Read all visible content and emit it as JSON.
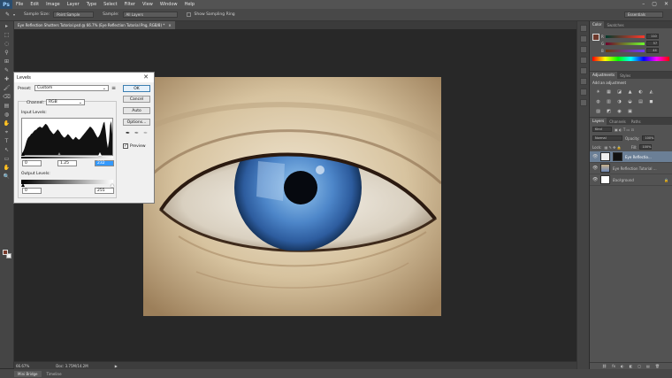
{
  "app": {
    "logo": "Ps"
  },
  "menu": [
    "File",
    "Edit",
    "Image",
    "Layer",
    "Type",
    "Select",
    "Filter",
    "View",
    "Window",
    "Help"
  ],
  "window_controls": [
    "–",
    "▢",
    "✕"
  ],
  "options_bar": {
    "sample_size_label": "Sample Size:",
    "sample_size_value": "Point Sample",
    "sample_label": "Sample:",
    "sample_value": "All Layers",
    "show_ring_label": "Show Sampling Ring",
    "workspace_value": "Essentials"
  },
  "document_tab": {
    "title": "Eye Reflection Shutters Tutorial.psd @ 66.7% (Eye Reflection Tutorial Png, RGB/8) *",
    "close": "×"
  },
  "status_bar": {
    "zoom": "66.67%",
    "doc": "Doc: 3.75M/14.2M",
    "arrow": "▶"
  },
  "bottom_tabs": [
    "Mini Bridge",
    "Timeline"
  ],
  "color_panel": {
    "tabs": [
      "Color",
      "Swatches"
    ],
    "rows": [
      {
        "label": "R",
        "value": "110",
        "track": "#ff6e6e"
      },
      {
        "label": "G",
        "value": "57",
        "track": "#6eff6e"
      },
      {
        "label": "B",
        "value": "44",
        "track": "#6e6eff"
      }
    ],
    "fg_color": "#6e392c"
  },
  "adjustments_panel": {
    "tabs": [
      "Adjustments",
      "Styles"
    ],
    "heading": "Add an adjustment",
    "icons": [
      "☀",
      "▦",
      "◪",
      "▲",
      "◐",
      "◭",
      "◍",
      "▥",
      "◑",
      "◒",
      "▤",
      "◼",
      "▨",
      "◩",
      "◉",
      "▣"
    ]
  },
  "layers_panel": {
    "tabs": [
      "Layers",
      "Channels",
      "Paths"
    ],
    "kind_label": "Kind",
    "blend_mode": "Normal",
    "opacity_label": "Opacity:",
    "opacity_value": "100%",
    "lock_label": "Lock:",
    "fill_label": "Fill:",
    "fill_value": "100%",
    "layers": [
      {
        "name": "Eye Reflectio...",
        "selected": true
      },
      {
        "name": "Eye Reflection Tutorial ...",
        "selected": false
      },
      {
        "name": "Background",
        "selected": false,
        "locked": "🔒"
      }
    ],
    "footer_icons": [
      "⛓",
      "fx",
      "◐",
      "◧",
      "▢",
      "▤",
      "🗑"
    ]
  },
  "levels_dialog": {
    "title": "Levels",
    "close": "✕",
    "preset_label": "Preset:",
    "preset_value": "Custom",
    "preset_menu_icon": "≡",
    "channel_label": "Channel:",
    "channel_value": "RGB",
    "input_levels_label": "Input Levels:",
    "input_levels": [
      "0",
      "1.25",
      "232"
    ],
    "output_levels_label": "Output Levels:",
    "output_levels": [
      "0",
      "255"
    ],
    "buttons": [
      "OK",
      "Cancel",
      "Auto",
      "Options..."
    ],
    "preview_label": "Preview",
    "preview_checked": true,
    "histogram_heights": [
      0.05,
      0.1,
      0.18,
      0.28,
      0.4,
      0.48,
      0.52,
      0.55,
      0.6,
      0.62,
      0.66,
      0.7,
      0.72,
      0.74,
      0.78,
      0.8,
      0.82,
      0.8,
      0.78,
      0.82,
      0.86,
      0.9,
      0.88,
      0.84,
      0.78,
      0.72,
      0.68,
      0.64,
      0.6,
      0.62,
      0.66,
      0.7,
      0.74,
      0.7,
      0.66,
      0.6,
      0.56,
      0.52,
      0.5,
      0.52,
      0.56,
      0.6,
      0.58,
      0.54,
      0.5,
      0.46,
      0.44,
      0.48,
      0.52,
      0.5,
      0.46,
      0.44,
      0.46,
      0.5,
      0.54,
      0.58,
      0.62,
      0.66,
      0.7,
      0.74,
      0.78,
      0.82,
      0.8,
      0.76,
      0.72,
      0.66,
      0.6,
      0.54,
      0.5,
      0.54,
      0.6,
      0.7,
      0.8,
      0.92,
      0.96,
      0.7,
      0.4,
      0.2,
      0.4,
      0.86,
      0.98,
      0.6
    ]
  },
  "tools": [
    "▸",
    "⬚",
    "◌",
    "⚲",
    "⊞",
    "✎",
    "✚",
    "🖌",
    "⌫",
    "▤",
    "◍",
    "✋",
    "⌖",
    "T",
    "↖",
    "▭",
    "✋",
    "🔍"
  ]
}
